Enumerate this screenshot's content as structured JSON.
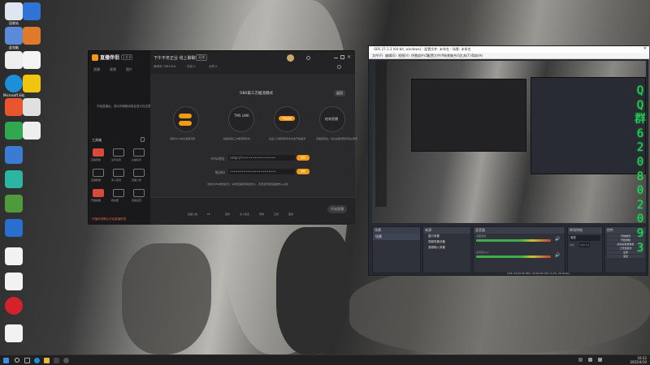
{
  "desktop": {
    "icons": [
      "回收站",
      "此电脑",
      "网络",
      "控制面板",
      "QQ",
      "Microsoft Edge",
      "腾讯视频",
      "Wegame",
      "QQ音乐",
      "直播伴侣",
      "OBS Studio",
      "微信",
      "网易云音乐",
      "新建文本文档",
      "文件"
    ]
  },
  "streaming_app": {
    "logo": "直播伴侣",
    "version": "1.0.0",
    "side_tabs": [
      "直播",
      "视频",
      "图片"
    ],
    "empty_hint": "开始直播后，观众的弹幕消息会显示在这里",
    "toolbox_title": "工具箱",
    "tools": [
      "直播回放",
      "房管设置",
      "主播任务",
      "直播数据",
      "多人连线",
      "直播公告",
      "开播提醒",
      "粉丝团",
      "直播设置"
    ],
    "bottom_notice": "开播前请确认开启直播权限",
    "title": "下午不务正业 线上聊聊",
    "tag": "直播",
    "stats": [
      "房间号 7981916",
      "在线 0",
      "点赞 0"
    ],
    "panel_title": "OBS第三方推流模式",
    "help_button": "返回",
    "steps": [
      {
        "label": "复制rtmp地址和推流码",
        "sub": "",
        "btn": "复制"
      },
      {
        "label": "TMS LINK",
        "sub": "粘贴到第三方推流软件中",
        "btn": ""
      },
      {
        "label": "开始直播",
        "sub": "在第三方推流软件中点击开始推流",
        "btn": "开始直播"
      },
      {
        "label": "结束直播",
        "sub": "直播结束后，请先在推流软件停止推流",
        "btn": ""
      }
    ],
    "rtmp_label": "rtmp地址",
    "rtmp_value": "rtmp://••••••••••••••••••",
    "key_label": "推流码",
    "key_value": "••••••••••••••••••••••••",
    "copy_label": "复制",
    "footnote": "当前为OBS推流模式，请勿泄露推流码给他人，否则会导致直播被他人占用",
    "bottom_tools": [
      "直播公告",
      "PK",
      "连线",
      "多人连麦",
      "特效",
      "互动",
      "更多"
    ],
    "start_button": "开始直播"
  },
  "obs": {
    "title": "OBS 27.1.3 (64-bit, windows) - 配置文件: 未命名 - 场景: 未命名",
    "menu": [
      "文件(F)",
      "编辑(E)",
      "视图(V)",
      "停靠部件(D)",
      "配置文件(P)",
      "场景集合(S)",
      "工具(T)",
      "帮助(H)"
    ],
    "docks": {
      "scenes": {
        "header": "场景",
        "items": [
          "场景"
        ]
      },
      "sources": {
        "header": "来源",
        "items": [
          "窗口采集",
          "视频采集设备",
          "音频输入采集"
        ]
      },
      "mixer": {
        "header": "混音器",
        "tracks": [
          "桌面音频",
          "麦克风/Aux"
        ]
      },
      "transitions": {
        "header": "转场特效",
        "value": "渐变",
        "duration_label": "时长",
        "duration": "300 ms"
      },
      "controls": {
        "header": "控件",
        "buttons": [
          "开始推流",
          "开始录制",
          "启动虚拟摄像机",
          "工作室模式",
          "设置",
          "退出"
        ]
      }
    },
    "status": "LIVE: 00:00:00  REC: 00:00:00  CPU: 2.4%, 30.00 fps"
  },
  "overlay_text": "Q Q 群 6 2 0 8 0 2 0 9 3",
  "taskbar": {
    "time": "16:32",
    "date": "2022/4/10"
  },
  "colors": {
    "accent": "#f39a12",
    "obs_bg": "#272a33",
    "green_text": "#33d35a"
  }
}
